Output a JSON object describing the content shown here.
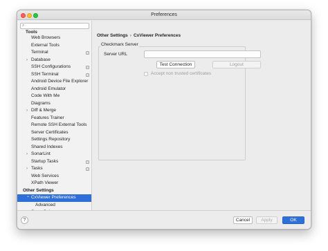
{
  "window": {
    "title": "Preferences"
  },
  "sidebar": {
    "search": {
      "placeholder": "",
      "value": "",
      "icon": "search-icon"
    },
    "groups": [
      {
        "label": "Tools"
      },
      {
        "label": "Other Settings"
      }
    ],
    "tools_items": [
      {
        "label": "Web Browsers",
        "has_arrow": false,
        "project_icon": false
      },
      {
        "label": "External Tools",
        "has_arrow": false,
        "project_icon": false
      },
      {
        "label": "Terminal",
        "has_arrow": false,
        "project_icon": true
      },
      {
        "label": "Database",
        "has_arrow": true,
        "project_icon": false
      },
      {
        "label": "SSH Configurations",
        "has_arrow": false,
        "project_icon": true
      },
      {
        "label": "SSH Terminal",
        "has_arrow": false,
        "project_icon": true
      },
      {
        "label": "Android Device File Explorer",
        "has_arrow": false,
        "project_icon": false
      },
      {
        "label": "Android Emulator",
        "has_arrow": false,
        "project_icon": false
      },
      {
        "label": "Code With Me",
        "has_arrow": false,
        "project_icon": false
      },
      {
        "label": "Diagrams",
        "has_arrow": false,
        "project_icon": false
      },
      {
        "label": "Diff & Merge",
        "has_arrow": true,
        "project_icon": false
      },
      {
        "label": "Features Trainer",
        "has_arrow": false,
        "project_icon": false
      },
      {
        "label": "Remote SSH External Tools",
        "has_arrow": false,
        "project_icon": false
      },
      {
        "label": "Server Certificates",
        "has_arrow": false,
        "project_icon": false
      },
      {
        "label": "Settings Repository",
        "has_arrow": false,
        "project_icon": false
      },
      {
        "label": "Shared Indexes",
        "has_arrow": false,
        "project_icon": false
      },
      {
        "label": "SonarLint",
        "has_arrow": true,
        "project_icon": false
      },
      {
        "label": "Startup Tasks",
        "has_arrow": false,
        "project_icon": true
      },
      {
        "label": "Tasks",
        "has_arrow": true,
        "project_icon": true
      },
      {
        "label": "Web Services",
        "has_arrow": false,
        "project_icon": false
      },
      {
        "label": "XPath Viewer",
        "has_arrow": false,
        "project_icon": false
      }
    ],
    "other_items": [
      {
        "label": "CxViewer Preferences",
        "selected": true,
        "expanded": true
      },
      {
        "label": "Advanced",
        "sub": true
      },
      {
        "label": "SonarQube"
      }
    ]
  },
  "content": {
    "breadcrumb": {
      "parent": "Other Settings",
      "separator": "›",
      "current": "CxViewer Preferences"
    },
    "group_title": "Checkmarx Server",
    "server_url_label": "Server URL",
    "server_url_value": "",
    "test_connection_label": "Test Connection",
    "logout_label": "Logout",
    "accept_untrusted_label": "Accept non trusted certificates",
    "accept_untrusted_checked": false
  },
  "footer": {
    "help_label": "?",
    "cancel_label": "Cancel",
    "apply_label": "Apply",
    "ok_label": "OK"
  },
  "colors": {
    "accent": "#2f6fd8",
    "close": "#fe5f57",
    "minimize": "#febc2e",
    "zoom": "#28c840"
  }
}
